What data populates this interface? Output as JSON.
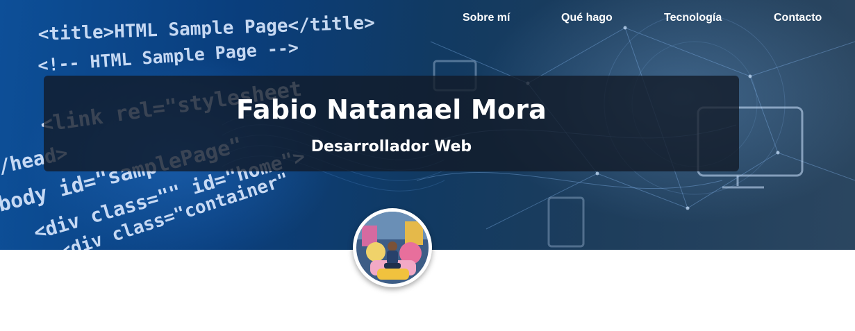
{
  "nav": {
    "items": [
      {
        "label": "Sobre mí"
      },
      {
        "label": "Qué hago"
      },
      {
        "label": "Tecnología"
      },
      {
        "label": "Contacto"
      }
    ]
  },
  "hero": {
    "name": "Fabio Natanael Mora",
    "role": "Desarrollador Web",
    "code_lines": [
      "<title>HTML Sample Page</title>",
      "<!-- HTML Sample Page -->",
      "<link rel=\"stylesheet",
      "/head>",
      "body id=\"samplePage\"",
      "<div class=\"\" id=\"home\">",
      "<div class=\"container\""
    ]
  },
  "colors": {
    "hero_dark": "#0a3e7c",
    "banner_bg": "#121a26",
    "text": "#ffffff"
  }
}
